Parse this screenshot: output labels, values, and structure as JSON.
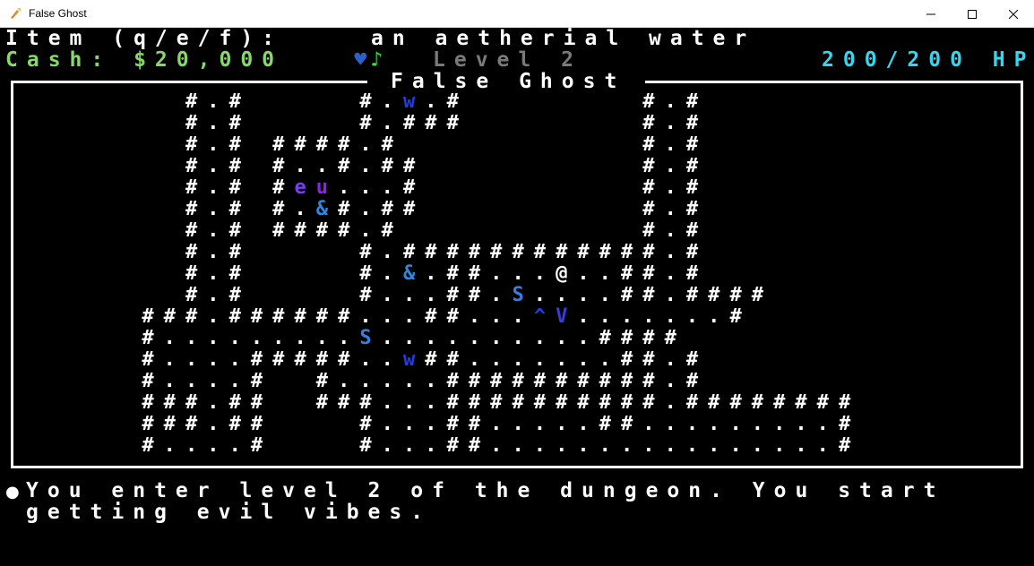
{
  "window": {
    "title": "False Ghost",
    "minimize_glyph": "—",
    "maximize_glyph": "☐",
    "close_glyph": "✕",
    "icon": "game-app-icon"
  },
  "hud": {
    "item_label": "Item (q/e/f):",
    "item_icons": [
      "heart-icon",
      "music-note-icon"
    ],
    "item_icon_heart": "♥",
    "item_icon_note": "♪",
    "item_name": "an aetherial water",
    "cash": "Cash: $20,000",
    "level": "Level 2",
    "hp": "200/200 HP"
  },
  "map": {
    "title": "False Ghost",
    "rows": [
      "      #.#     #.w.#        #.#",
      "      #.#     #.###        #.#",
      "      #.# ####.#           #.#",
      "      #.# #..#.##          #.#",
      "      #.# #eu...#          #.#",
      "      #.# #.&#.##          #.#",
      "      #.# ####.#           #.#",
      "      #.#     #.############.#",
      "      #.#     #.&.##...@..##.#",
      "      #.#     #...##.S....##.####",
      "    ###.######...##...^V.......#",
      "    #.........S..........####",
      "    #....#####..w##.......##.#",
      "    #....#  #.....##########.#",
      "    ###.##  ###...##########.########",
      "    ###.##    #...##.....##.........#",
      "    #....#    #...##................#"
    ],
    "colors": {
      "default": "#ffffff",
      "w": "#1f3ee8",
      "e": "#7b3df0",
      "u": "#8f1ff0",
      "&": "#2f86e0",
      "S": "#3a7de0",
      "^": "#1f3ee8",
      "V": "#3a3ae0",
      "@": "#ffffff"
    }
  },
  "messages": [
    "You enter level 2 of the dungeon. You start",
    "getting evil vibes."
  ],
  "colors": {
    "background": "#000000",
    "cash": "#86d86b",
    "level": "#7a7a7a",
    "hp": "#35d6f0",
    "heart": "#2a62c9",
    "note": "#3fdc3f"
  }
}
